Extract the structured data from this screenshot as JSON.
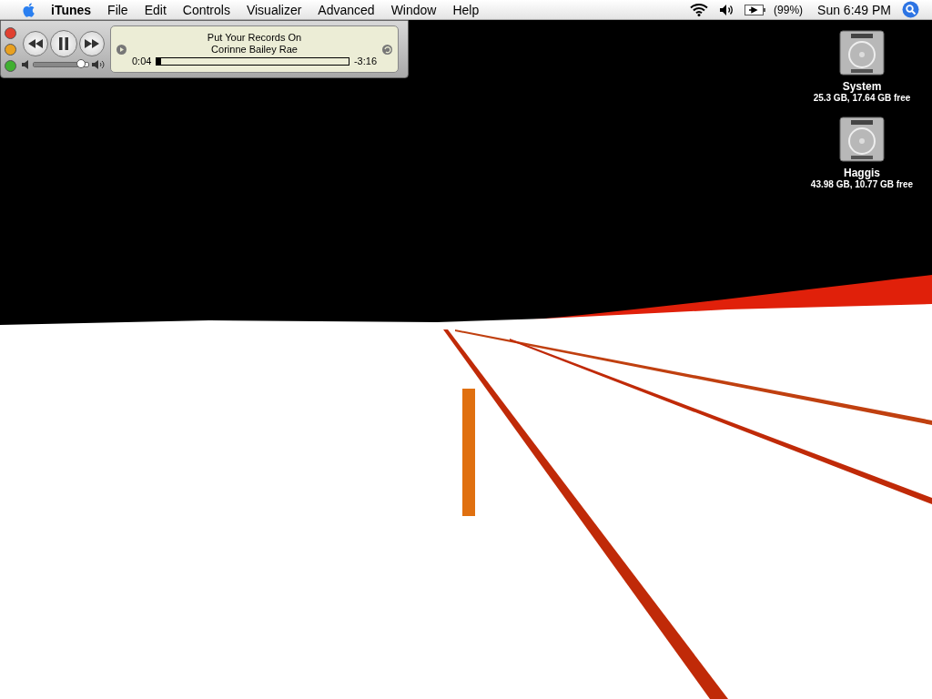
{
  "menu_bar": {
    "app_name": "iTunes",
    "menus": [
      "File",
      "Edit",
      "Controls",
      "Visualizer",
      "Advanced",
      "Window",
      "Help"
    ],
    "battery": "(99%)",
    "clock": "Sun 6:49 PM"
  },
  "mini_player": {
    "playing": true,
    "title": "Put Your Records On",
    "artist": "Corinne Bailey Rae",
    "elapsed": "0:04",
    "remaining": "-3:16",
    "progress": {
      "level": 0.02
    },
    "volume": {
      "level": 0.87
    }
  },
  "desktop_icons": [
    {
      "name": "System",
      "info": "25.3 GB, 17.64 GB free"
    },
    {
      "name": "Haggis",
      "info": "43.98 GB, 10.77 GB free"
    }
  ]
}
